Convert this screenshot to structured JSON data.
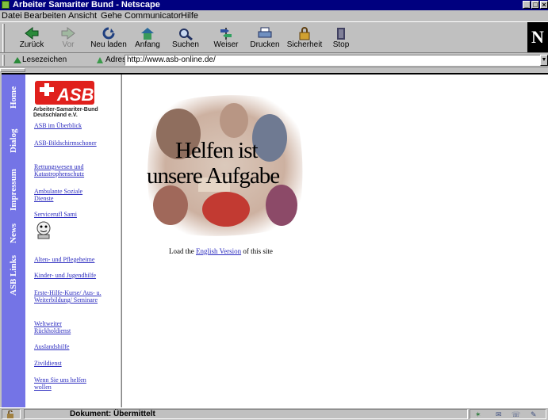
{
  "window": {
    "title": "Arbeiter Samariter Bund - Netscape"
  },
  "menu": [
    "Datei",
    "Bearbeiten",
    "Ansicht",
    "Gehe",
    "Communicator",
    "Hilfe"
  ],
  "toolbar": {
    "buttons": [
      {
        "label": "Zurück",
        "icon": "back-arrow-icon",
        "enabled": true
      },
      {
        "label": "Vor",
        "icon": "forward-arrow-icon",
        "enabled": false
      },
      {
        "label": "Neu laden",
        "icon": "reload-icon",
        "enabled": true
      },
      {
        "label": "Anfang",
        "icon": "home-icon",
        "enabled": true
      },
      {
        "label": "Suchen",
        "icon": "search-icon",
        "enabled": true
      },
      {
        "label": "Weiser",
        "icon": "guide-icon",
        "enabled": true
      },
      {
        "label": "Drucken",
        "icon": "print-icon",
        "enabled": true
      },
      {
        "label": "Sicherheit",
        "icon": "security-lock-icon",
        "enabled": true
      },
      {
        "label": "Stop",
        "icon": "stop-icon",
        "enabled": true
      }
    ],
    "brand": "N"
  },
  "location": {
    "bookmarks_label": "Lesezeichen",
    "address_label": "Adresse:",
    "url": "http://www.asb-online.de/"
  },
  "nav_vertical": [
    "Home",
    "Dialog",
    "Impressum",
    "News",
    "ASB Links"
  ],
  "left": {
    "logo_text": "ASB",
    "logo_sub_1": "Arbeiter-Samariter-Bund",
    "logo_sub_2": "Deutschland e.V.",
    "links": [
      {
        "text": "ASB im Überblick"
      },
      {
        "text": "ASB-Bildschirmschoner"
      },
      {
        "text": "Rettungswesen und Katastrophenschutz"
      },
      {
        "text": "Ambulante Soziale Dienste"
      },
      {
        "text": "Servicerufl Sami"
      },
      {
        "text": "Alten- und Pflegeheime"
      },
      {
        "text": "Kinder- und Jugendhilfe"
      },
      {
        "text": "Erste-Hilfe-Kurse/ Aus- u. Weiterbildung/ Seminare"
      },
      {
        "text": "Weltweiter Rückholdienst"
      },
      {
        "text": "Auslandshilfe"
      },
      {
        "text": "Zivildienst"
      },
      {
        "text": "Wenn Sie uns helfen wollen"
      }
    ]
  },
  "main": {
    "hero_line1": "Helfen ist",
    "hero_line2": "unsere Aufgabe",
    "load_prefix": "Load the",
    "load_link": "English Version",
    "load_suffix": "of this site"
  },
  "status": {
    "text": "Dokument: Übermittelt"
  },
  "colors": {
    "titlebar": "#00007f",
    "nav": "#7474e6",
    "link": "#2b2bbf",
    "asb_red": "#e0201c"
  }
}
